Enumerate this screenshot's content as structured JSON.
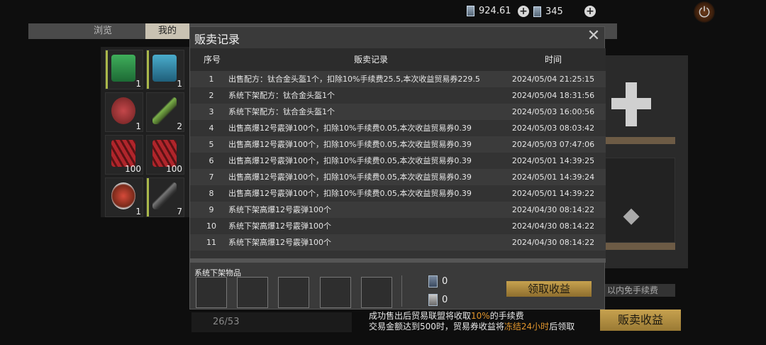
{
  "topbar": {
    "currency1_value": "924.61",
    "currency2_value": "345",
    "power_icon": "power-icon"
  },
  "bg_page": {
    "tabs": [
      "浏览",
      "我的"
    ],
    "inventory": [
      {
        "count": "1",
        "icon": "green-pack-icon"
      },
      {
        "count": "1",
        "icon": "blue-pack-icon"
      },
      {
        "count": "1",
        "icon": "meat-icon"
      },
      {
        "count": "2",
        "icon": "syringe-icon"
      },
      {
        "count": "100",
        "icon": "red-ammo-icon"
      },
      {
        "count": "100",
        "icon": "red-ammo-icon"
      },
      {
        "count": "1",
        "icon": "food-icon"
      },
      {
        "count": "7",
        "icon": "weapon-part-icon"
      }
    ],
    "counter": "26/53",
    "fee_tip_partial": "以内免手续费",
    "sell_income_button": "贩卖收益"
  },
  "fee_info": {
    "line1_a": "成功售出后贸易联盟将收取",
    "line1_pct": "10%",
    "line1_b": "的手续费",
    "line2_a": "交易金额达到500时，贸易券收益将",
    "line2_hl": "冻结24小时",
    "line2_b": "后领取"
  },
  "modal": {
    "title": "贩卖记录",
    "headers": {
      "no": "序号",
      "record": "贩卖记录",
      "time": "时间"
    },
    "rows": [
      {
        "no": "1",
        "record": "出售配方：钛合金头盔1个，扣除10%手续费25.5,本次收益贸易券229.5",
        "time": "2024/05/04 21:25:15"
      },
      {
        "no": "2",
        "record": "系统下架配方：钛合金头盔1个",
        "time": "2024/05/04 18:31:56"
      },
      {
        "no": "3",
        "record": "系统下架配方：钛合金头盔1个",
        "time": "2024/05/03 16:00:56"
      },
      {
        "no": "4",
        "record": "出售高爆12号霰弹100个，扣除10%手续费0.05,本次收益贸易券0.39",
        "time": "2024/05/03 08:03:42"
      },
      {
        "no": "5",
        "record": "出售高爆12号霰弹100个，扣除10%手续费0.05,本次收益贸易券0.39",
        "time": "2024/05/03 07:47:06"
      },
      {
        "no": "6",
        "record": "出售高爆12号霰弹100个，扣除10%手续费0.05,本次收益贸易券0.39",
        "time": "2024/05/01 14:39:25"
      },
      {
        "no": "7",
        "record": "出售高爆12号霰弹100个，扣除10%手续费0.05,本次收益贸易券0.39",
        "time": "2024/05/01 14:39:24"
      },
      {
        "no": "8",
        "record": "出售高爆12号霰弹100个，扣除10%手续费0.05,本次收益贸易券0.39",
        "time": "2024/05/01 14:39:22"
      },
      {
        "no": "9",
        "record": "系统下架高爆12号霰弹100个",
        "time": "2024/04/30 08:14:22"
      },
      {
        "no": "10",
        "record": "系统下架高爆12号霰弹100个",
        "time": "2024/04/30 08:14:22"
      },
      {
        "no": "11",
        "record": "系统下架高爆12号霰弹100个",
        "time": "2024/04/30 08:14:22"
      }
    ],
    "delist_title": "系统下架物品",
    "ticket_gold_count": "0",
    "ticket_silver_count": "0",
    "claim_button": "领取收益"
  }
}
